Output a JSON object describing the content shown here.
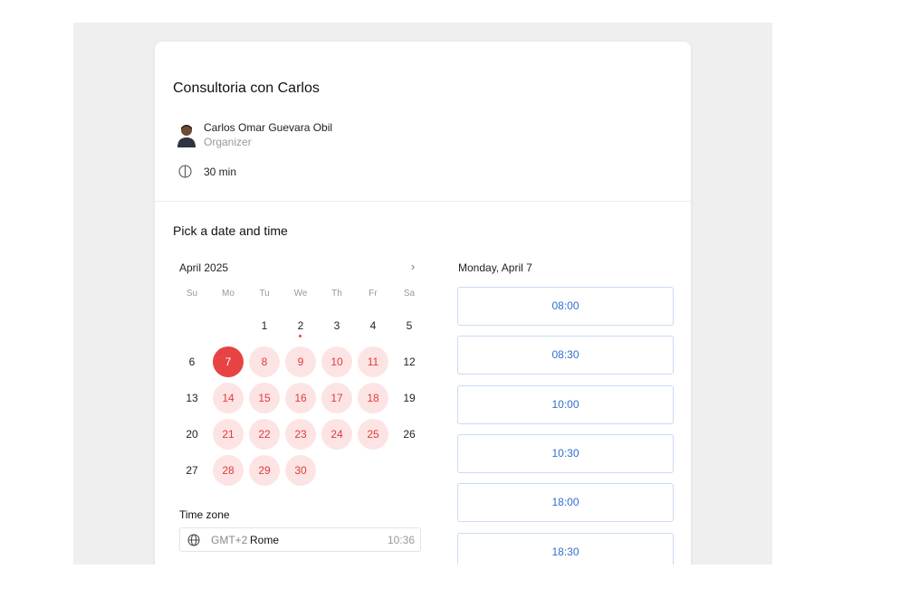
{
  "event": {
    "title": "Consultoria con Carlos",
    "organizer_name": "Carlos Omar Guevara Obil",
    "organizer_role": "Organizer",
    "duration": "30 min"
  },
  "picker": {
    "title": "Pick a date and time",
    "month": "April 2025",
    "next_icon": "chevron-right-icon",
    "next_label": "›",
    "weekdays": [
      "Su",
      "Mo",
      "Tu",
      "We",
      "Th",
      "Fr",
      "Sa"
    ],
    "days": [
      {
        "label": "1",
        "state": "disabled"
      },
      {
        "label": "2",
        "state": "today"
      },
      {
        "label": "3",
        "state": "disabled"
      },
      {
        "label": "4",
        "state": "disabled"
      },
      {
        "label": "5",
        "state": "disabled"
      },
      {
        "label": "6",
        "state": "disabled"
      },
      {
        "label": "7",
        "state": "selected"
      },
      {
        "label": "8",
        "state": "available"
      },
      {
        "label": "9",
        "state": "available"
      },
      {
        "label": "10",
        "state": "available"
      },
      {
        "label": "11",
        "state": "available"
      },
      {
        "label": "12",
        "state": "disabled"
      },
      {
        "label": "13",
        "state": "disabled"
      },
      {
        "label": "14",
        "state": "available"
      },
      {
        "label": "15",
        "state": "available"
      },
      {
        "label": "16",
        "state": "available"
      },
      {
        "label": "17",
        "state": "available"
      },
      {
        "label": "18",
        "state": "available"
      },
      {
        "label": "19",
        "state": "disabled"
      },
      {
        "label": "20",
        "state": "disabled"
      },
      {
        "label": "21",
        "state": "available"
      },
      {
        "label": "22",
        "state": "available"
      },
      {
        "label": "23",
        "state": "available"
      },
      {
        "label": "24",
        "state": "available"
      },
      {
        "label": "25",
        "state": "available"
      },
      {
        "label": "26",
        "state": "disabled"
      },
      {
        "label": "27",
        "state": "disabled"
      },
      {
        "label": "28",
        "state": "available"
      },
      {
        "label": "29",
        "state": "available"
      },
      {
        "label": "30",
        "state": "available"
      }
    ]
  },
  "timezone": {
    "label": "Time zone",
    "offset": "GMT+2",
    "city": "Rome",
    "current_time": "10:36",
    "icon": "globe-icon"
  },
  "slots": {
    "date_label": "Monday, April 7",
    "times": [
      "08:00",
      "08:30",
      "10:00",
      "10:30",
      "18:00",
      "18:30"
    ]
  },
  "colors": {
    "accent": "#e84343",
    "available_bg": "#fde4e4",
    "slot_text": "#2f6fd1",
    "slot_border": "#c9dbf3"
  }
}
